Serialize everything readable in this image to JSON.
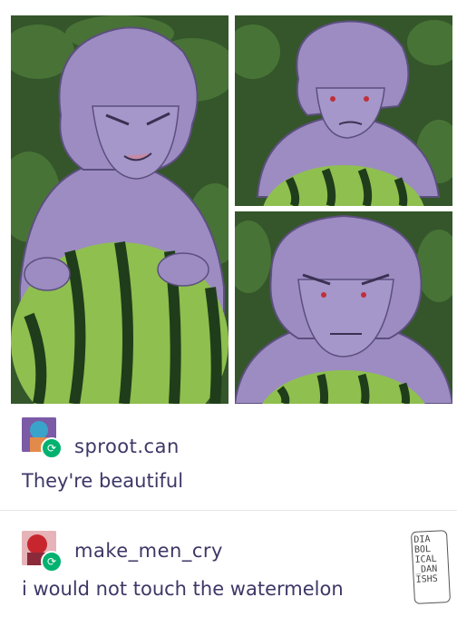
{
  "colors": {
    "character": "#9c8cc2",
    "character_outline": "#5c4f7e",
    "watermelon_dark": "#1f3d1a",
    "watermelon_light": "#8fbf4f",
    "foliage": "#2e4d25",
    "text": "#3d3766",
    "reblog_badge": "#00b26f"
  },
  "comic": {
    "panels": [
      {
        "id": "panel-1",
        "description_icon": "character-holding-watermelon"
      },
      {
        "id": "panel-2",
        "description_icon": "character-peeking-watermelon"
      },
      {
        "id": "panel-3",
        "description_icon": "character-glaring-watermelon"
      }
    ]
  },
  "posts": [
    {
      "username": "sproot.can",
      "text": "They're beautiful",
      "avatar_icon": "avatar-purple-character",
      "badge_icon": "reblog-icon"
    },
    {
      "username": "make_men_cry",
      "text": "i would not touch the watermelon",
      "avatar_icon": "avatar-red-character",
      "badge_icon": "reblog-icon"
    }
  ],
  "signature": {
    "lines": [
      "DIA",
      "BOL",
      "ICAL",
      "_DAN",
      "ISHS"
    ]
  },
  "reblog_glyph": "⟳"
}
